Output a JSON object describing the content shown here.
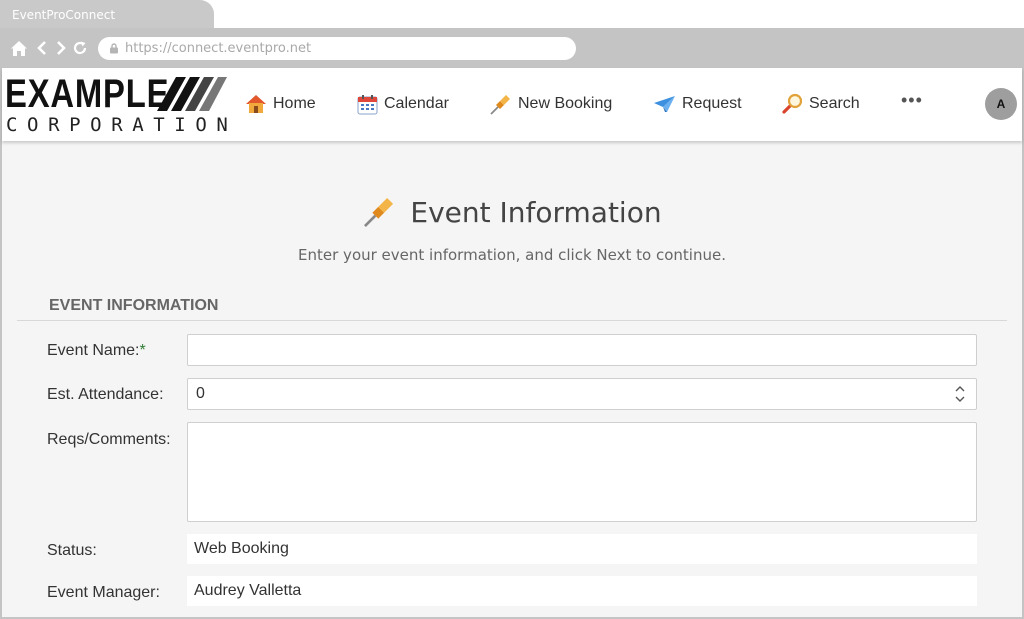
{
  "browser": {
    "tab_title": "EventProConnect",
    "url": "https://connect.eventpro.net"
  },
  "logo": {
    "line1": "EXAMPLE",
    "line2": "CORPORATION"
  },
  "nav": {
    "items": [
      {
        "label": "Home",
        "icon": "house-icon"
      },
      {
        "label": "Calendar",
        "icon": "calendar-icon"
      },
      {
        "label": "New Booking",
        "icon": "pushpin-icon"
      },
      {
        "label": "Request",
        "icon": "paper-plane-icon"
      },
      {
        "label": "Search",
        "icon": "magnifier-icon"
      }
    ],
    "more": "•••",
    "avatar": "A"
  },
  "page": {
    "title": "Event Information",
    "subtitle": "Enter your event information, and click Next to continue."
  },
  "section": {
    "title": "EVENT INFORMATION"
  },
  "form": {
    "event_name_label": "Event Name:",
    "required_mark": "*",
    "event_name_value": "",
    "attendance_label": "Est. Attendance:",
    "attendance_value": "0",
    "comments_label": "Reqs/Comments:",
    "comments_value": "",
    "status_label": "Status:",
    "status_value": "Web Booking",
    "manager_label": "Event Manager:",
    "manager_value": "Audrey Valletta"
  },
  "colors": {
    "page_bg": "#f5f5f5",
    "chrome_gray": "#c4c4c4",
    "required_green": "#2e7d32",
    "avatar_gray": "#9e9e9e"
  }
}
